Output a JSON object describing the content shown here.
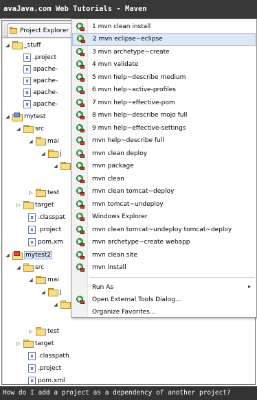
{
  "window": {
    "title": "avaJava.com Web Tutorials - Maven"
  },
  "view": {
    "tab_label": "Project Explorer"
  },
  "tree": [
    {
      "label": "_stuff",
      "kind": "folder",
      "toggle": "expanded"
    },
    {
      "label": ".project",
      "kind": "file",
      "glyph": "x"
    },
    {
      "label": "apache-",
      "kind": "file",
      "glyph": "xs"
    },
    {
      "label": "apache-",
      "kind": "file",
      "glyph": "xs"
    },
    {
      "label": "apache-",
      "kind": "file",
      "glyph": "xs"
    },
    {
      "label": "apache-",
      "kind": "file",
      "glyph": "xs"
    },
    {
      "label": "mytest",
      "kind": "project",
      "toggle": "expanded"
    },
    {
      "label": "src",
      "kind": "folder",
      "toggle": "expanded"
    },
    {
      "label": "mai",
      "kind": "folder",
      "toggle": "expanded"
    },
    {
      "label": "j",
      "kind": "folder",
      "toggle": "expanded"
    },
    {
      "label": "",
      "kind": "folder",
      "toggle": "expanded"
    },
    {
      "label": "test",
      "kind": "folder",
      "toggle": "collapsed"
    },
    {
      "label": "target",
      "kind": "folder",
      "toggle": "collapsed"
    },
    {
      "label": ".classpat",
      "kind": "file",
      "glyph": "x"
    },
    {
      "label": ".project",
      "kind": "file",
      "glyph": "x"
    },
    {
      "label": "pom.xm",
      "kind": "file",
      "glyph": "x"
    },
    {
      "label": "mytest2",
      "kind": "project-red",
      "toggle": "expanded",
      "selected": true
    },
    {
      "label": "src",
      "kind": "folder",
      "toggle": "expanded"
    },
    {
      "label": "mai",
      "kind": "folder",
      "toggle": "expanded"
    },
    {
      "label": "j",
      "kind": "folder",
      "toggle": "expanded"
    },
    {
      "label": "",
      "kind": "folder",
      "toggle": "expanded"
    },
    {
      "label": "test",
      "kind": "folder",
      "toggle": "collapsed"
    },
    {
      "label": "target",
      "kind": "folder",
      "toggle": "collapsed"
    },
    {
      "label": ".classpath",
      "kind": "file",
      "glyph": "x"
    },
    {
      "label": ".project",
      "kind": "file",
      "glyph": "x"
    },
    {
      "label": "pom.xml",
      "kind": "file",
      "glyph": "x"
    }
  ],
  "menu": {
    "items": [
      {
        "label": "1 mvn clean install",
        "icon": "run-icon"
      },
      {
        "label": "2 mvn eclipse~eclipse",
        "icon": "run-icon",
        "highlighted": true
      },
      {
        "label": "3 mvn archetype~create",
        "icon": "run-icon"
      },
      {
        "label": "4 mvn validate",
        "icon": "run-icon"
      },
      {
        "label": "5 mvn help~describe medium",
        "icon": "run-icon"
      },
      {
        "label": "6 mvn help~active-profiles",
        "icon": "run-icon"
      },
      {
        "label": "7 mvn help~effective-pom",
        "icon": "run-icon"
      },
      {
        "label": "8 mvn help~describe mojo full",
        "icon": "run-icon"
      },
      {
        "label": "9 mvn help~effective-settings",
        "icon": "run-icon"
      },
      {
        "label": "mvn help~describe full",
        "icon": "run-icon"
      },
      {
        "label": "mvn clean deploy",
        "icon": "run-icon"
      },
      {
        "label": "mvn package",
        "icon": "run-icon"
      },
      {
        "label": "mvn clean",
        "icon": "run-icon"
      },
      {
        "label": "mvn clean tomcat~deploy",
        "icon": "run-icon"
      },
      {
        "label": "mvn tomcat~undeploy",
        "icon": "run-icon"
      },
      {
        "label": "Windows Explorer",
        "icon": "run-icon"
      },
      {
        "label": "mvn clean tomcat~undeploy tomcat~deploy",
        "icon": "run-icon"
      },
      {
        "label": "mvn archetype~create webapp",
        "icon": "run-icon"
      },
      {
        "label": "mvn clean site",
        "icon": "run-icon"
      },
      {
        "label": "mvn install",
        "icon": "run-icon"
      }
    ],
    "run_as": {
      "label": "Run As",
      "submenu_arrow": "▸"
    },
    "open_dialog": {
      "label": "Open External Tools Dialog...",
      "icon": "run-icon"
    },
    "organize": {
      "label": "Organize Favorites..."
    }
  },
  "status": {
    "text": "How do I add a project as a dependency of another project?"
  },
  "colors": {
    "titlebar": "#383838",
    "statusbar": "#333333",
    "menu_highlight": "#dde8f7"
  }
}
